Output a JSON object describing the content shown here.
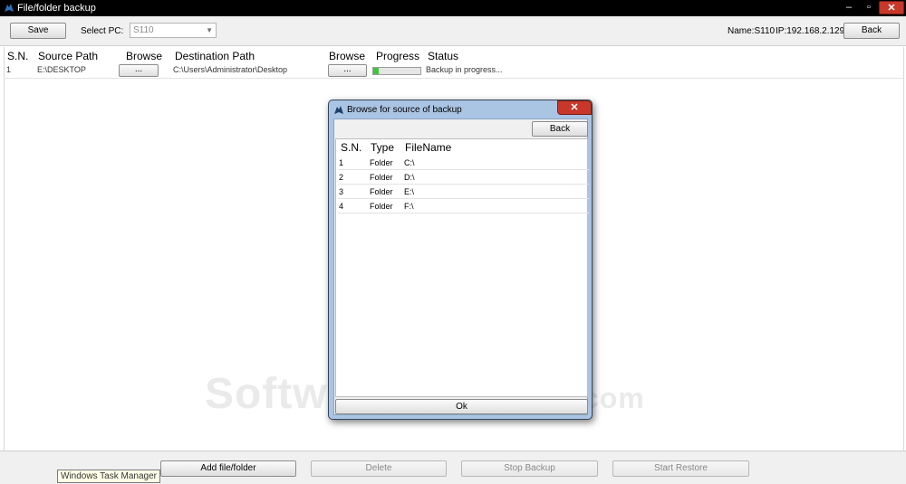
{
  "window": {
    "title": "File/folder backup",
    "controls": {
      "minimize": "–",
      "maximize": "▫",
      "close": "✕"
    }
  },
  "toolbar": {
    "save_label": "Save",
    "select_pc_label": "Select PC:",
    "select_pc_value": "S110",
    "name_label": "Name:S110",
    "ip_label": "IP:192.168.2.129",
    "back_label": "Back"
  },
  "grid": {
    "columns": [
      "S.N.",
      "Source Path",
      "Browse",
      "Destination Path",
      "Browse",
      "Progress",
      "Status"
    ],
    "rows": [
      {
        "sn": "1",
        "source": "E:\\DESKTOP",
        "browse1": "...",
        "destination": "C:\\Users\\Administrator\\Desktop",
        "browse2": "...",
        "progress": 0.12,
        "status": "Backup in progress..."
      }
    ]
  },
  "dialog": {
    "title": "Browse for source of backup",
    "close": "✕",
    "back_label": "Back",
    "ok_label": "Ok",
    "columns": [
      "S.N.",
      "Type",
      "FileName"
    ],
    "rows": [
      {
        "sn": "1",
        "type": "Folder",
        "name": "C:\\"
      },
      {
        "sn": "2",
        "type": "Folder",
        "name": "D:\\"
      },
      {
        "sn": "3",
        "type": "Folder",
        "name": "E:\\"
      },
      {
        "sn": "4",
        "type": "Folder",
        "name": "F:\\"
      }
    ]
  },
  "bottom": {
    "add_label": "Add file/folder",
    "delete_label": "Delete",
    "stop_label": "Stop Backup",
    "restore_label": "Start Restore",
    "tooltip": "Windows Task Manager"
  },
  "watermark": {
    "main": "SoftwareSuggest",
    "suffix": ".com"
  },
  "colors": {
    "progress_fill": "#3ec63e",
    "title_bar": "#000000",
    "dialog_frame": "#aac4e4",
    "close_button": "#c7382b"
  }
}
